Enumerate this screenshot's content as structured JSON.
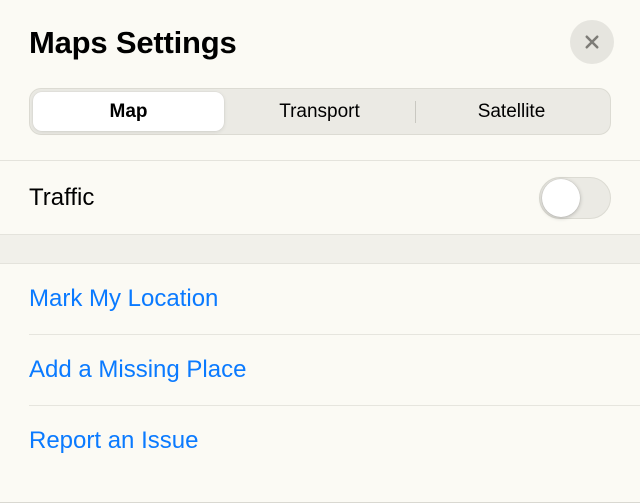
{
  "header": {
    "title": "Maps Settings"
  },
  "tabs": {
    "items": [
      {
        "label": "Map",
        "selected": true
      },
      {
        "label": "Transport",
        "selected": false
      },
      {
        "label": "Satellite",
        "selected": false
      }
    ]
  },
  "traffic": {
    "label": "Traffic",
    "on": false
  },
  "actions": {
    "mark": "Mark My Location",
    "add": "Add a Missing Place",
    "report": "Report an Issue"
  }
}
